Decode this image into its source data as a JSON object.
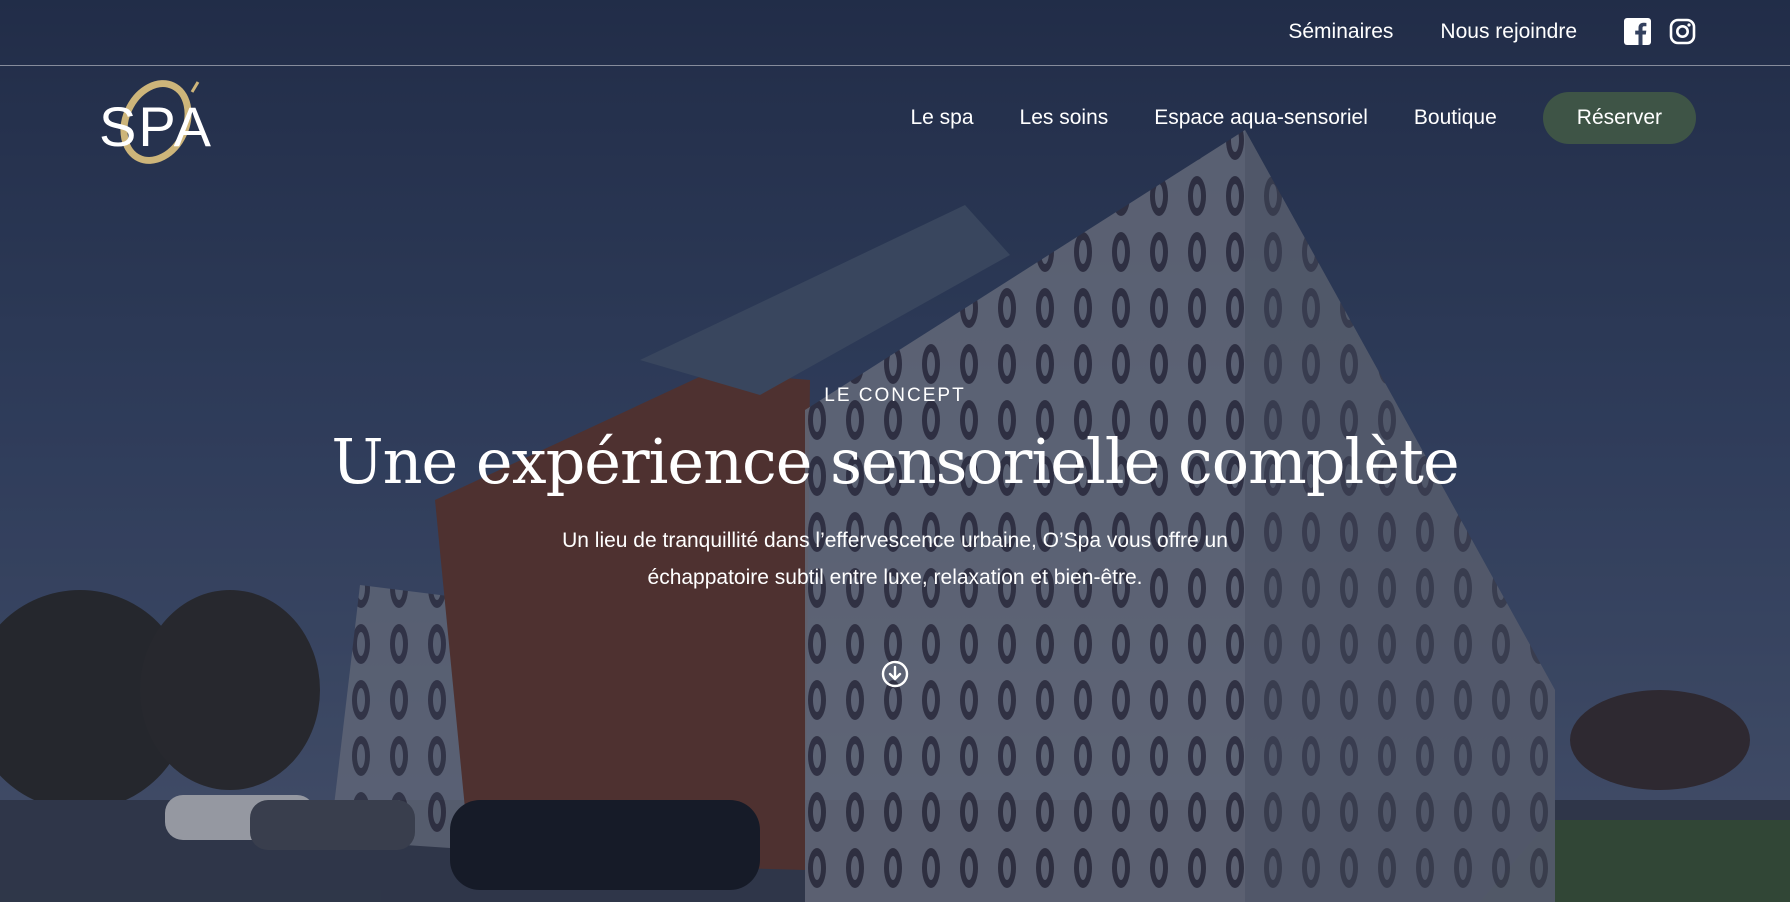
{
  "topbar": {
    "links": [
      "Séminaires",
      "Nous rejoindre"
    ],
    "social": [
      "facebook-icon",
      "instagram-icon"
    ]
  },
  "logo": {
    "text": "SPA",
    "accent_letter": "O"
  },
  "nav": {
    "items": [
      "Le spa",
      "Les soins",
      "Espace aqua-sensoriel",
      "Boutique"
    ],
    "cta": "Réserver"
  },
  "hero": {
    "eyebrow": "LE CONCEPT",
    "title": "Une expérience sensorielle complète",
    "description": "Un lieu de tranquillité dans l’effervescence urbaine, O’Spa vous offre un échappatoire subtil entre luxe, relaxation et bien-être.",
    "scroll_icon": "arrow-down-circle-icon"
  },
  "colors": {
    "cta_bg": "#3e5446",
    "logo_gold": "#cdb57a",
    "sky": "#2d3b57"
  }
}
